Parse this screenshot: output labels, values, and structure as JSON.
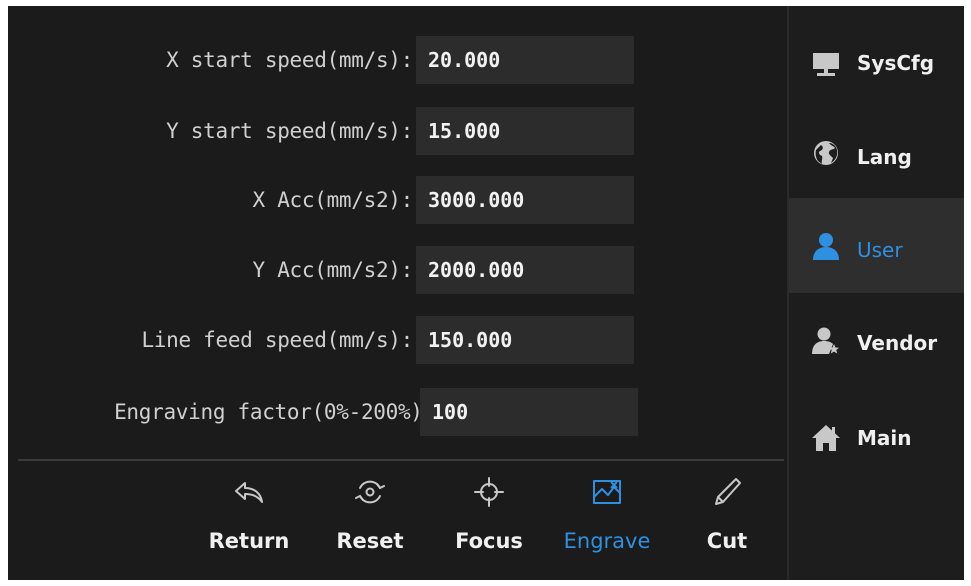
{
  "form": {
    "rows": [
      {
        "label": "X start speed(mm/s):",
        "value": "20.000"
      },
      {
        "label": "Y start speed(mm/s):",
        "value": "15.000"
      },
      {
        "label": "X Acc(mm/s2):",
        "value": "3000.000"
      },
      {
        "label": "Y Acc(mm/s2):",
        "value": "2000.000"
      },
      {
        "label": "Line feed speed(mm/s):",
        "value": "150.000"
      },
      {
        "label": "Engraving factor(0%-200%):",
        "value": "100"
      }
    ]
  },
  "toolbar": {
    "items": [
      {
        "label": "Return",
        "icon": "return-icon"
      },
      {
        "label": "Reset",
        "icon": "reset-icon"
      },
      {
        "label": "Focus",
        "icon": "crosshair-icon"
      },
      {
        "label": "Engrave",
        "icon": "engrave-icon",
        "active": true
      },
      {
        "label": "Cut",
        "icon": "pen-icon"
      }
    ]
  },
  "sidebar": {
    "items": [
      {
        "label": "SysCfg",
        "icon": "monitor-icon"
      },
      {
        "label": "Lang",
        "icon": "globe-icon"
      },
      {
        "label": "User",
        "icon": "user-icon",
        "active": true
      },
      {
        "label": "Vendor",
        "icon": "user-star-icon"
      },
      {
        "label": "Main",
        "icon": "home-icon"
      }
    ]
  },
  "colors": {
    "background": "#1b1b1b",
    "field": "#2c2c2c",
    "accent": "#2f8fe0",
    "text": "#f0f0f0"
  }
}
